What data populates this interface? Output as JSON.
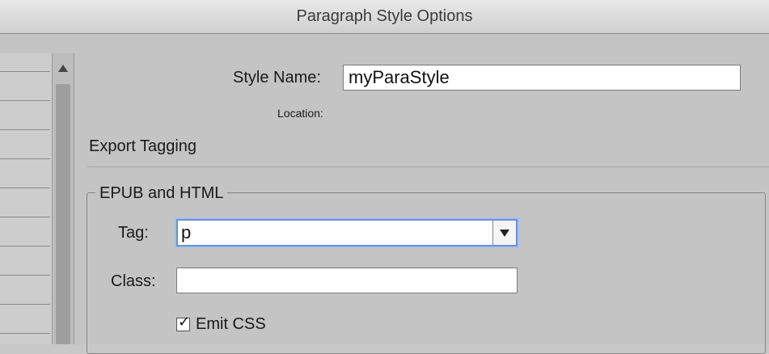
{
  "window": {
    "title": "Paragraph Style Options"
  },
  "general": {
    "style_name_label": "Style Name:",
    "style_name_value": "myParaStyle",
    "location_label": "Location:"
  },
  "export_tagging": {
    "heading": "Export Tagging",
    "epub_html": {
      "group_title": "EPUB and HTML",
      "tag_label": "Tag:",
      "tag_value": "p",
      "class_label": "Class:",
      "class_value": "",
      "emit_css_label": "Emit CSS",
      "emit_css_checked": true
    }
  },
  "icons": {
    "scroll_up": "up-triangle",
    "dropdown": "down-triangle",
    "checkmark": "check"
  }
}
